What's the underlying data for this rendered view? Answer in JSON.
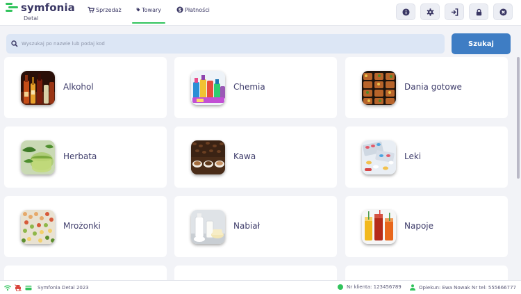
{
  "app": {
    "logo_text": "symfonia",
    "logo_sub": "Detal"
  },
  "nav": {
    "sales": "Sprzedaż",
    "goods": "Towary",
    "payments": "Płatności"
  },
  "toolbar": {
    "buttons": [
      "info-icon",
      "gear-icon",
      "logout-icon",
      "lock-icon",
      "close-icon"
    ]
  },
  "search": {
    "placeholder": "Wyszukaj po nazwie lub podaj kod",
    "button_label": "Szukaj"
  },
  "categories": [
    {
      "label": "Alkohol",
      "icon": "alcohol-bottles-image"
    },
    {
      "label": "Chemia",
      "icon": "cleaning-products-image"
    },
    {
      "label": "Dania gotowe",
      "icon": "ready-meals-image"
    },
    {
      "label": "Herbata",
      "icon": "tea-image"
    },
    {
      "label": "Kawa",
      "icon": "coffee-image"
    },
    {
      "label": "Leki",
      "icon": "pills-image"
    },
    {
      "label": "Mrożonki",
      "icon": "frozen-vegetables-image"
    },
    {
      "label": "Nabiał",
      "icon": "dairy-image"
    },
    {
      "label": "Napoje",
      "icon": "drinks-image"
    }
  ],
  "footer": {
    "app_name": "Symfonia Detal 2023",
    "client_label": "Nr klienta: 123456789",
    "carer_label": "Opiekun: Ewa Nowak Nr tel: 555666777"
  },
  "colors": {
    "accent_green": "#31c35c",
    "primary_blue": "#3e7dc4",
    "text_dark": "#3f3d6b",
    "search_bg": "#dce6f5"
  }
}
